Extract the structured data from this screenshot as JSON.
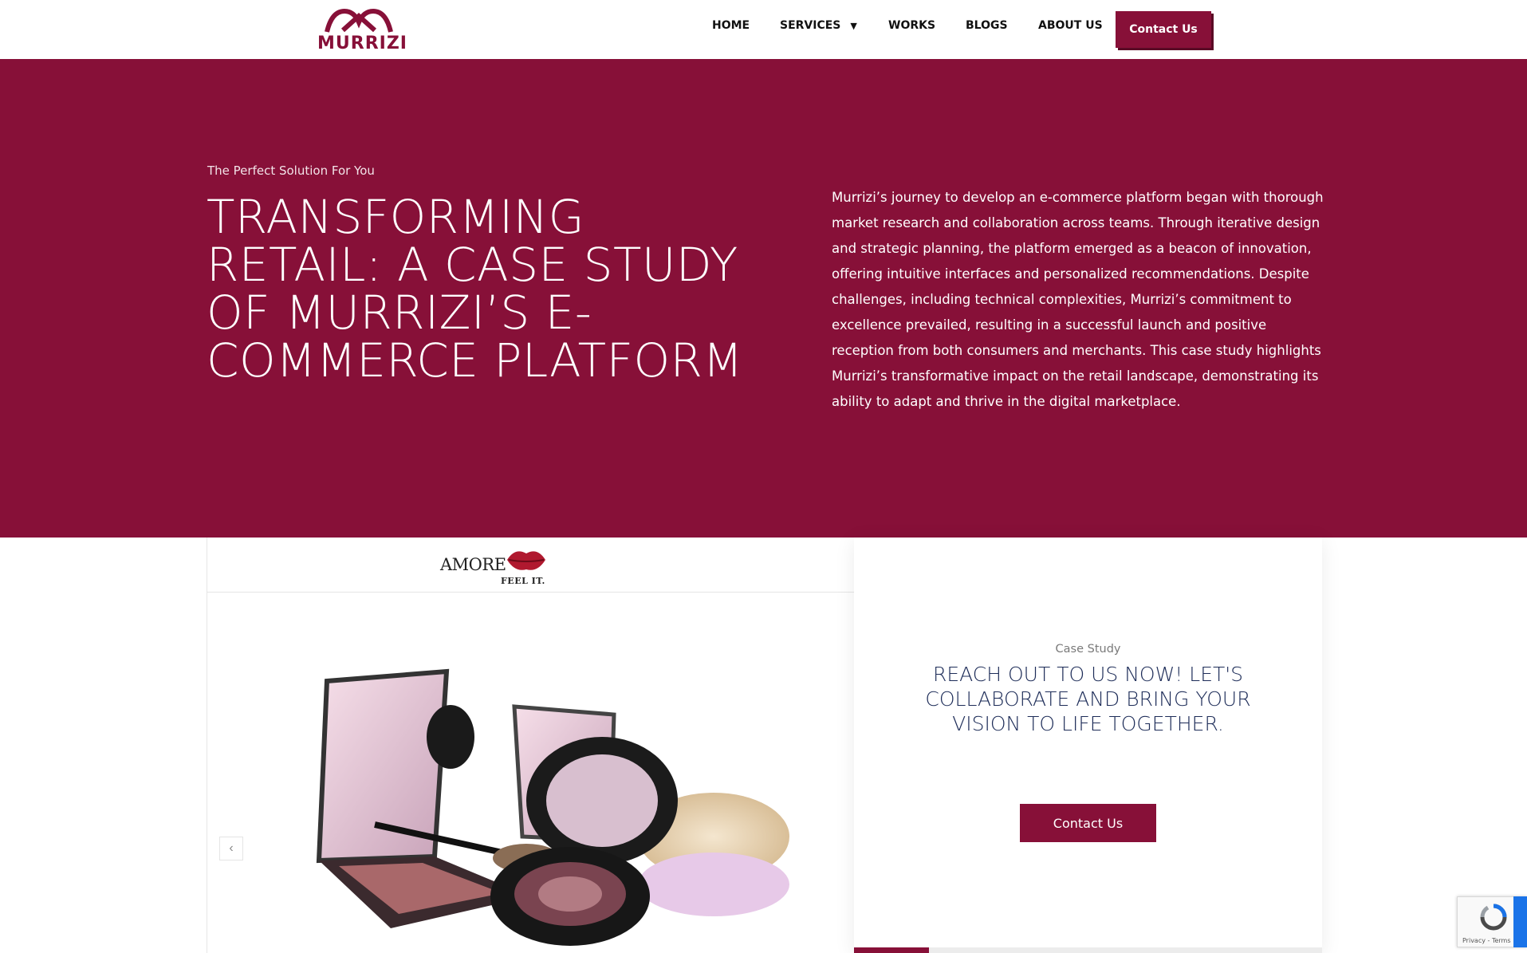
{
  "header": {
    "logo_text": "MURRIZI",
    "nav": {
      "home": "HOME",
      "services": "SERVICES",
      "works": "WORKS",
      "blogs": "BLOGS",
      "about": "ABOUT US"
    },
    "contact_label": "Contact Us"
  },
  "hero": {
    "subtitle": "The Perfect Solution For You",
    "title": "TRANSFORMING RETAIL: A CASE STUDY OF MURRIZI’S E-COMMERCE PLATFORM",
    "body": "Murrizi’s journey to develop an e-commerce platform began with thorough market research and collaboration across teams. Through iterative design and strategic planning, the platform emerged as a beacon of innovation, offering intuitive interfaces and personalized recommendations. Despite challenges, including technical complexities, Murrizi’s commitment to excellence prevailed, resulting in a successful launch and positive reception from both consumers and merchants. This case study highlights Murrizi’s transformative impact on the retail landscape, demonstrating its ability to adapt and thrive in the digital marketplace."
  },
  "slider": {
    "brand_name": "AMORE",
    "brand_tagline": "FEEL IT.",
    "prev_icon": "chevron-left-icon"
  },
  "case_card": {
    "label": "Case Study",
    "title": "REACH OUT TO US NOW! LET'S COLLABORATE AND BRING YOUR VISION TO LIFE TOGETHER.",
    "button_label": "Contact Us",
    "slide_progress": 0.16
  },
  "recaptcha": {
    "text": "Privacy - Terms"
  },
  "colors": {
    "brand": "#871038",
    "heading_navy": "#1d2c58"
  }
}
